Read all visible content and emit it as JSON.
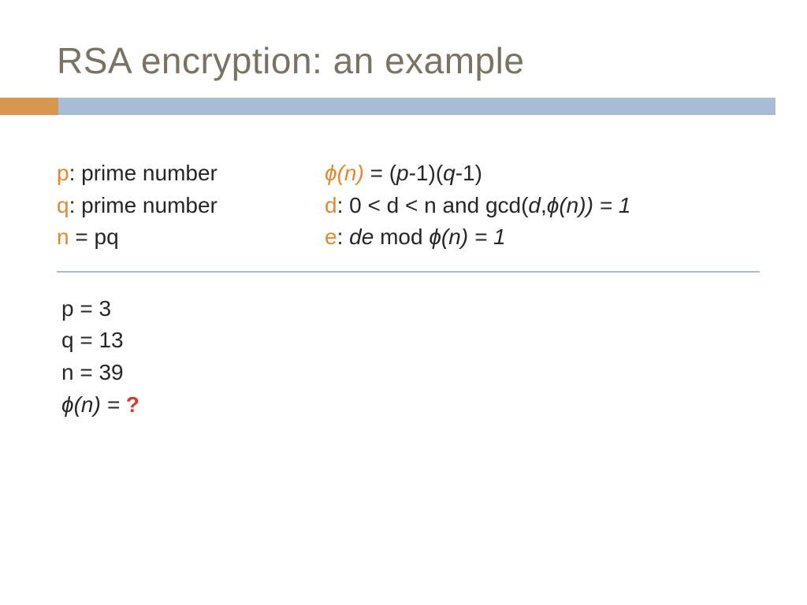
{
  "title": "RSA encryption: an example",
  "defs": {
    "p": {
      "sym": "p",
      "sep": ": ",
      "text": "prime number"
    },
    "q": {
      "sym": "q",
      "sep": ": ",
      "text": "prime number"
    },
    "n": {
      "sym": "n",
      "sep": "  = ",
      "text": "pq"
    },
    "phi": {
      "sym": "ϕ(n)",
      "eq": " = (",
      "p": "p",
      "mid1": "-1)(",
      "qv": "q",
      "mid2": "-1)"
    },
    "d": {
      "sym": "d",
      "sep": ":   ",
      "text1": "0 < d < n and gcd(",
      "dv": "d",
      "comma": ",",
      "phi": "ϕ(n)",
      "text2": ") = 1"
    },
    "e": {
      "sym": "e",
      "sep": ":   ",
      "de": "de",
      "mod": " mod ",
      "phi": "ϕ(n)",
      "eq": " = 1"
    }
  },
  "example": {
    "p": "p = 3",
    "q": "q = 13",
    "n": "n = 39",
    "phi_lhs": "ϕ(n) = ",
    "phi_q": "?"
  }
}
